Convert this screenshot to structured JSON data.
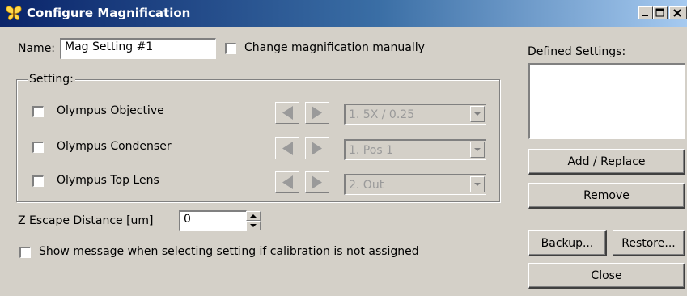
{
  "window": {
    "title": "Configure Magnification",
    "controls": {
      "minimize": "minimize-icon",
      "maximize": "maximize-icon",
      "close": "close-icon"
    }
  },
  "name_field": {
    "label": "Name:",
    "value": "Mag Setting #1"
  },
  "manual_checkbox": {
    "label": "Change magnification manually",
    "checked": false
  },
  "setting_group": {
    "title": "Setting:",
    "rows": [
      {
        "label": "Olympus Objective",
        "checked": false,
        "selected": "1. 5X / 0.25"
      },
      {
        "label": "Olympus Condenser",
        "checked": false,
        "selected": "1. Pos 1"
      },
      {
        "label": "Olympus Top Lens",
        "checked": false,
        "selected": "2. Out"
      }
    ]
  },
  "z_escape": {
    "label": "Z Escape Distance [um]",
    "value": "0"
  },
  "show_message_checkbox": {
    "label": "Show message when selecting setting if calibration is not assigned",
    "checked": false
  },
  "defined_settings": {
    "label": "Defined Settings:"
  },
  "buttons": {
    "add_replace": "Add / Replace",
    "remove": "Remove",
    "backup": "Backup...",
    "restore": "Restore...",
    "close": "Close"
  },
  "colors": {
    "titlebar_start": "#0a246a",
    "titlebar_end": "#a6caf0",
    "face": "#d4d0c8",
    "disabled_text": "#9a9a9a"
  }
}
